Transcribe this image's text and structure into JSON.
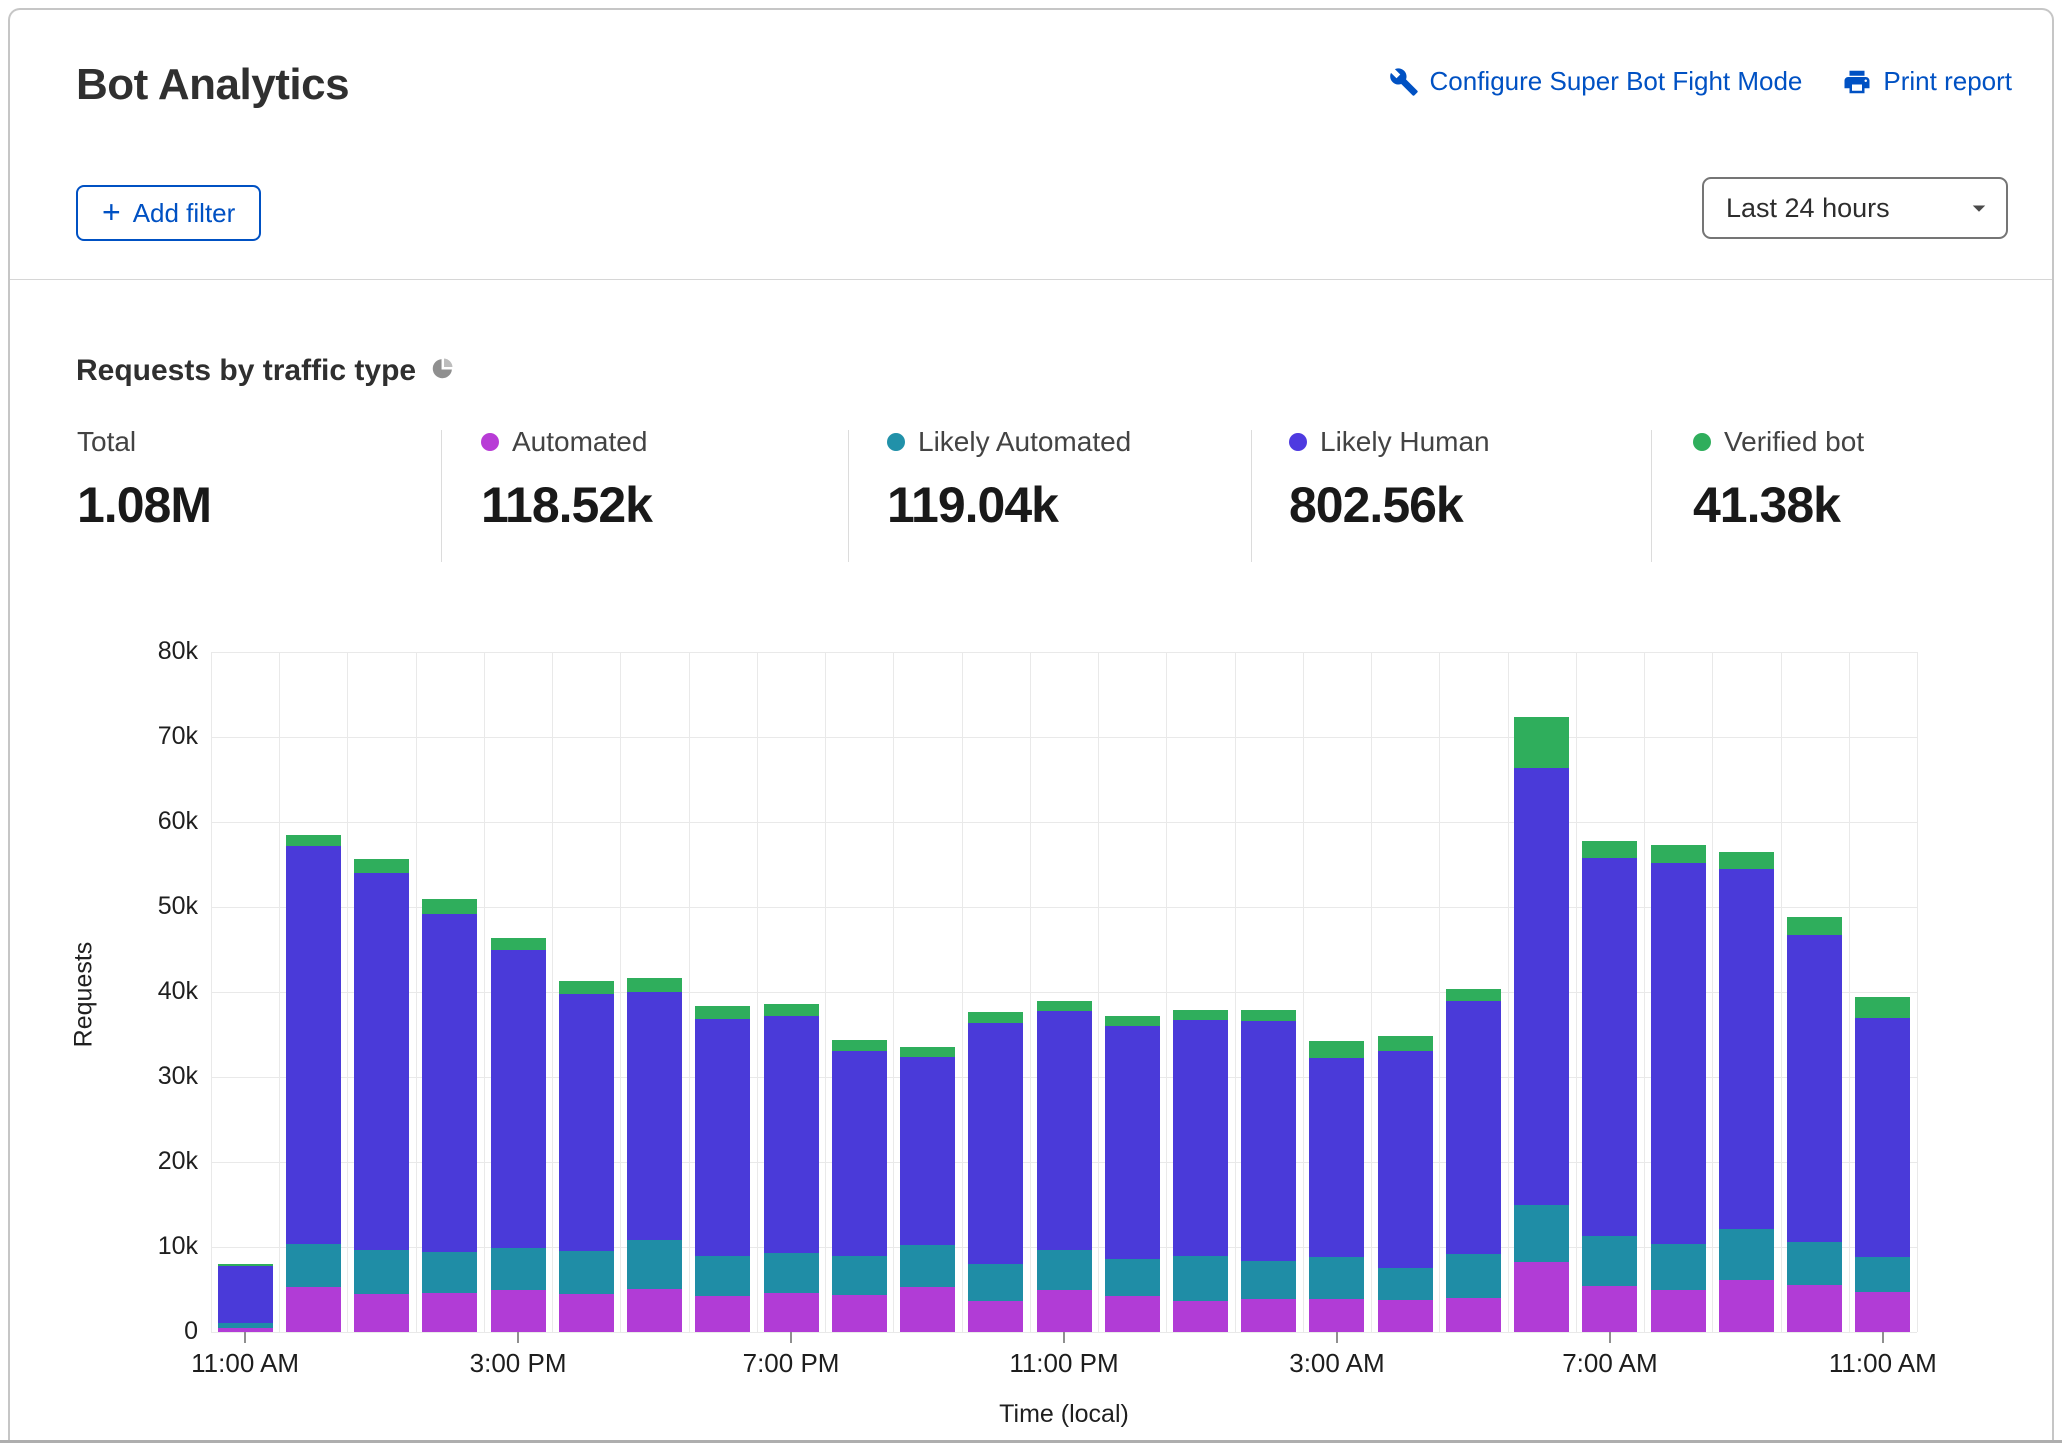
{
  "header": {
    "title": "Bot Analytics",
    "configure_link": "Configure Super Bot Fight Mode",
    "configure_icon": "wrench-icon",
    "print_link": "Print report",
    "print_icon": "printer-icon",
    "link_color": "#0051c3"
  },
  "toolbar": {
    "add_filter_label": "Add filter",
    "add_filter_icon": "plus-icon",
    "time_range_value": "Last 24 hours",
    "time_range_icon": "caret-down-icon"
  },
  "section": {
    "title": "Requests by traffic type",
    "icon": "pie-chart-icon"
  },
  "stats": [
    {
      "label": "Total",
      "value": "1.08M",
      "dot_color": null
    },
    {
      "label": "Automated",
      "value": "118.52k",
      "dot_color": "#b83cd6"
    },
    {
      "label": "Likely Automated",
      "value": "119.04k",
      "dot_color": "#2191a9"
    },
    {
      "label": "Likely Human",
      "value": "802.56k",
      "dot_color": "#4e3ae0"
    },
    {
      "label": "Verified bot",
      "value": "41.38k",
      "dot_color": "#2fae5c"
    }
  ],
  "chart_data": {
    "type": "bar",
    "stacked": true,
    "title": "Requests by traffic type",
    "xlabel": "Time (local)",
    "ylabel": "Requests",
    "ylim": [
      0,
      80000
    ],
    "grid": true,
    "bar_count": 25,
    "ytick_labels": [
      "0",
      "10k",
      "20k",
      "30k",
      "40k",
      "50k",
      "60k",
      "70k",
      "80k"
    ],
    "xtick_positions": [
      0,
      4,
      8,
      12,
      16,
      20,
      24
    ],
    "xtick_labels": [
      "11:00 AM",
      "3:00 PM",
      "7:00 PM",
      "11:00 PM",
      "3:00 AM",
      "7:00 AM",
      "11:00 AM"
    ],
    "series": [
      {
        "name": "Automated",
        "color": "#b13cd6",
        "values": [
          500,
          5300,
          4500,
          4600,
          5000,
          4500,
          5100,
          4200,
          4600,
          4400,
          5300,
          3700,
          4900,
          4200,
          3700,
          3900,
          3900,
          3800,
          4000,
          8200,
          5400,
          5000,
          6100,
          5500,
          4700
        ]
      },
      {
        "name": "Likely Automated",
        "color": "#1f8da6",
        "values": [
          600,
          5100,
          5200,
          4800,
          4900,
          5000,
          5700,
          4700,
          4700,
          4600,
          4900,
          4300,
          4700,
          4400,
          5200,
          4500,
          4900,
          3700,
          5200,
          6800,
          5900,
          5300,
          6000,
          5100,
          4100
        ]
      },
      {
        "name": "Likely Human",
        "color": "#4a3ad9",
        "values": [
          6700,
          46800,
          44300,
          39800,
          35000,
          30300,
          29200,
          27900,
          27900,
          24100,
          22100,
          28400,
          28200,
          27400,
          27800,
          28200,
          23400,
          25600,
          29800,
          51400,
          44500,
          44900,
          42400,
          36100,
          28100
        ]
      },
      {
        "name": "Verified bot",
        "color": "#2fae5c",
        "values": [
          200,
          1300,
          1600,
          1800,
          1400,
          1500,
          1700,
          1600,
          1400,
          1300,
          1200,
          1300,
          1100,
          1200,
          1200,
          1300,
          2000,
          1700,
          1400,
          5900,
          2000,
          2100,
          2000,
          2100,
          2500
        ]
      }
    ]
  }
}
